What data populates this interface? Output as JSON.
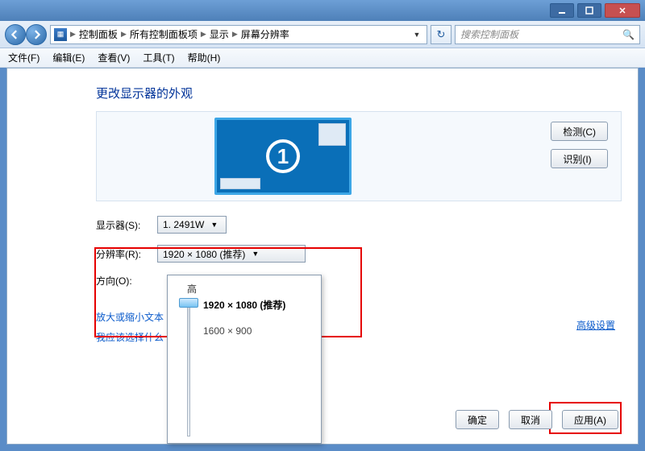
{
  "titlebar": {
    "min": "_",
    "max": "□",
    "close": "×"
  },
  "nav": {
    "crumbs": [
      "控制面板",
      "所有控制面板项",
      "显示",
      "屏幕分辨率"
    ],
    "search_placeholder": "搜索控制面板"
  },
  "menu": {
    "file": "文件(F)",
    "edit": "编辑(E)",
    "view": "查看(V)",
    "tools": "工具(T)",
    "help": "帮助(H)"
  },
  "page": {
    "title": "更改显示器的外观",
    "detect_btn": "检测(C)",
    "identify_btn": "识别(I)",
    "monitor_number": "1",
    "display_label": "显示器(S):",
    "display_value": "1. 2491W",
    "resolution_label": "分辨率(R):",
    "resolution_value": "1920 × 1080 (推荐)",
    "orientation_label": "方向(O):",
    "advanced": "高级设置",
    "link_textsize": "放大或缩小文本",
    "link_whatchoose": "我应该选择什么",
    "ok": "确定",
    "cancel": "取消",
    "apply": "应用(A)"
  },
  "slider": {
    "high": "高",
    "opt_recommended": "1920 × 1080 (推荐)",
    "opt_mid": "1600 × 900"
  }
}
